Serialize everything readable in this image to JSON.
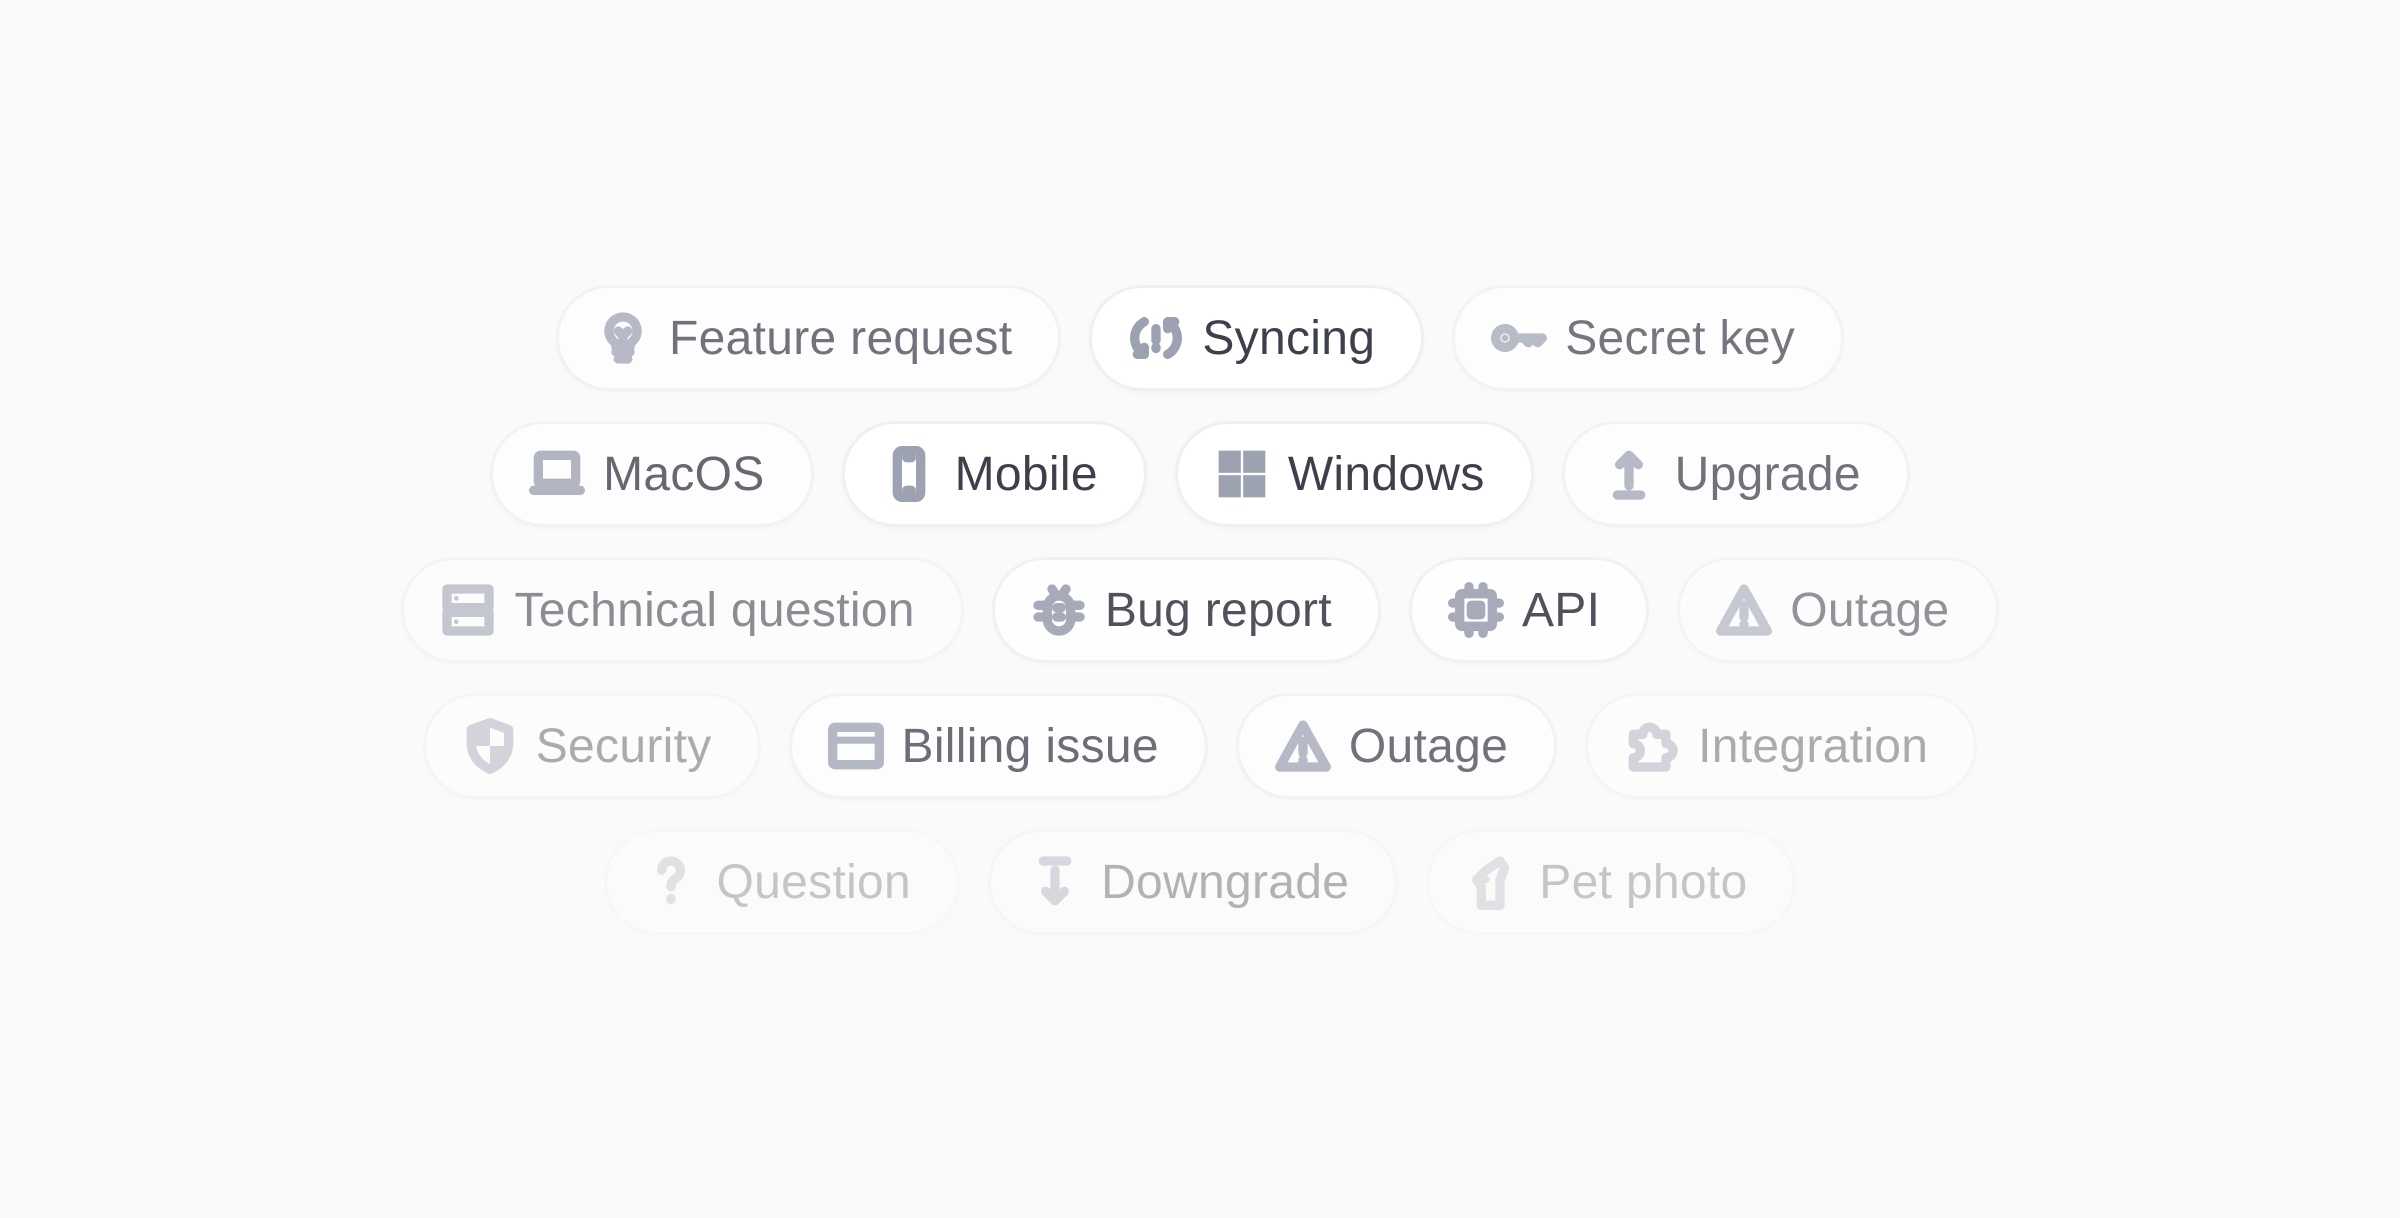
{
  "accent_icon_color": "#9da2b3",
  "text_color": "#3d3f4b",
  "rows": [
    [
      {
        "label": "Feature request",
        "icon": "lightbulb-icon"
      },
      {
        "label": "Syncing",
        "icon": "sync-alert-icon"
      },
      {
        "label": "Secret key",
        "icon": "key-icon"
      }
    ],
    [
      {
        "label": "MacOS",
        "icon": "laptop-icon"
      },
      {
        "label": "Mobile",
        "icon": "phone-icon"
      },
      {
        "label": "Windows",
        "icon": "windows-icon"
      },
      {
        "label": "Upgrade",
        "icon": "arrow-up-icon"
      }
    ],
    [
      {
        "label": "Technical question",
        "icon": "server-icon"
      },
      {
        "label": "Bug report",
        "icon": "bug-icon"
      },
      {
        "label": "API",
        "icon": "chip-icon"
      },
      {
        "label": "Outage",
        "icon": "warning-icon"
      }
    ],
    [
      {
        "label": "Security",
        "icon": "shield-icon"
      },
      {
        "label": "Billing issue",
        "icon": "credit-card-icon"
      },
      {
        "label": "Outage",
        "icon": "warning-icon"
      },
      {
        "label": "Integration",
        "icon": "puzzle-icon"
      }
    ],
    [
      {
        "label": "Question",
        "icon": "question-icon"
      },
      {
        "label": "Downgrade",
        "icon": "arrow-down-icon"
      },
      {
        "label": "Pet photo",
        "icon": "pet-icon"
      }
    ]
  ]
}
